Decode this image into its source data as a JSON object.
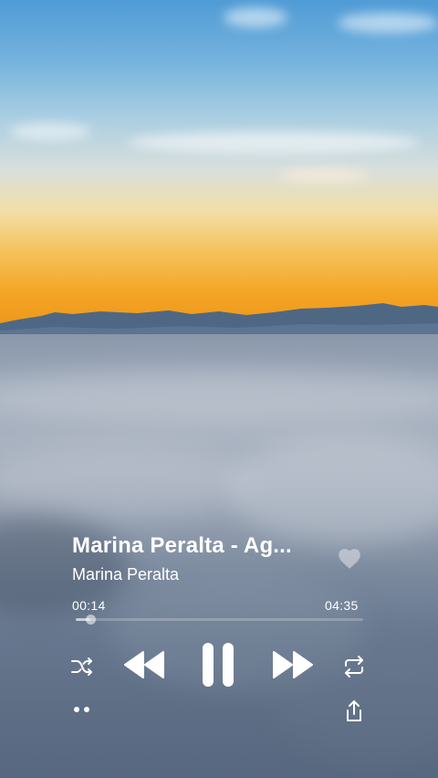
{
  "track": {
    "title": "Marina Peralta - Ag...",
    "artist": "Marina Peralta"
  },
  "playback": {
    "elapsed": "00:14",
    "duration": "04:35",
    "progress_fraction": 0.051,
    "state": "playing"
  },
  "icons": {
    "favorite": "heart-icon",
    "shuffle": "shuffle-icon",
    "previous": "rewind-icon",
    "play_pause": "pause-icon",
    "next": "fast-forward-icon",
    "repeat": "repeat-icon",
    "more": "more-dots-icon",
    "share": "share-icon"
  },
  "colors": {
    "text": "#ffffff",
    "heart": "#c9ced8"
  }
}
